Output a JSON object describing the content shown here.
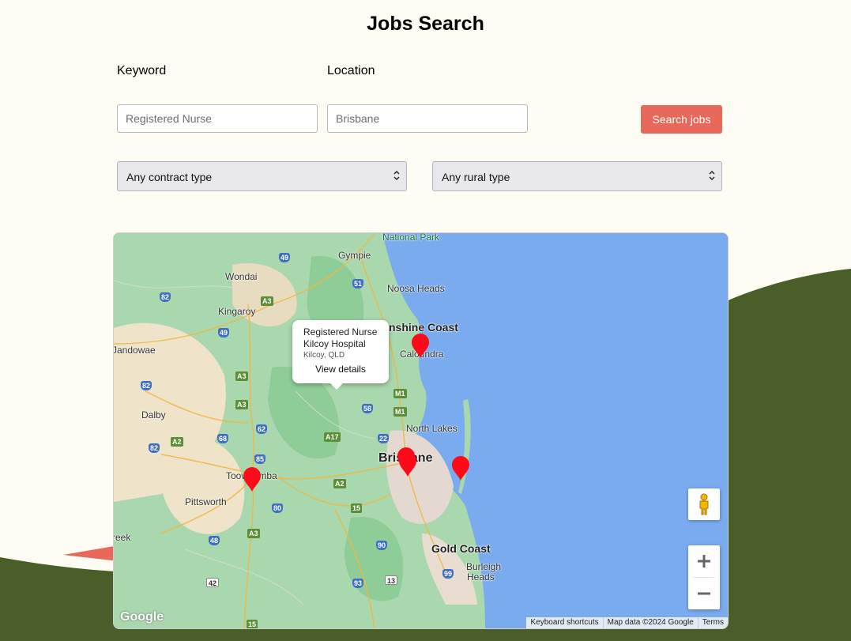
{
  "page": {
    "title": "Jobs Search"
  },
  "search": {
    "keyword_label": "Keyword",
    "keyword_placeholder": "Registered Nurse",
    "location_label": "Location",
    "location_placeholder": "Brisbane",
    "button_label": "Search jobs"
  },
  "filters": {
    "contract_type": "Any contract type",
    "rural_type": "Any rural type"
  },
  "colors": {
    "background": "#fffdf3",
    "accent_button": "#e8685a",
    "hill": "#4a5e2a",
    "marker": "#ff0a18"
  },
  "map": {
    "labels": {
      "national_park": "National Park",
      "gympie": "Gympie",
      "noosa": "Noosa Heads",
      "wondai": "Wondai",
      "kingaroy": "Kingaroy",
      "sunshine": "nshine Coast",
      "caloundra": "Caloundra",
      "jandowae": "Jandowae",
      "dalby": "Dalby",
      "north_lakes": "North Lakes",
      "brisbane": "Brisbane",
      "toowoomba": "Toowoomba",
      "pittsworth": "Pittsworth",
      "gold_coast": "Gold Coast",
      "burleigh1": "Burleigh",
      "burleigh2": "Heads",
      "creek": "reek"
    },
    "roads": {
      "r49": "49",
      "r51": "51",
      "r82": "82",
      "r82b": "82",
      "r82c": "82",
      "a3": "A3",
      "r49b": "49",
      "a3b": "A3",
      "a3c": "A3",
      "m1": "M1",
      "m1b": "M1",
      "r58": "58",
      "r68": "68",
      "r22": "22",
      "a17": "A17",
      "a2": "A2",
      "r62": "62",
      "r85": "85",
      "a2b": "A2",
      "r15": "15",
      "r80": "80",
      "a3d": "A3",
      "r90": "90",
      "r48": "48",
      "r99": "99",
      "r42": "42",
      "r93": "93",
      "r13": "13",
      "r15b": "15"
    },
    "info_window": {
      "job_title": "Registered Nurse",
      "employer": "Kilcoy Hospital",
      "location": "Kilcoy, QLD",
      "link": "View details"
    },
    "logo": "Google",
    "attribution": {
      "shortcuts": "Keyboard shortcuts",
      "map_data": "Map data ©2024 Google",
      "terms": "Terms"
    },
    "icons": {
      "pegman": "pegman-icon",
      "zoom_in": "plus-icon",
      "zoom_out": "minus-icon",
      "marker": "map-pin-icon",
      "select_arrow": "chevron-updown-icon"
    }
  }
}
